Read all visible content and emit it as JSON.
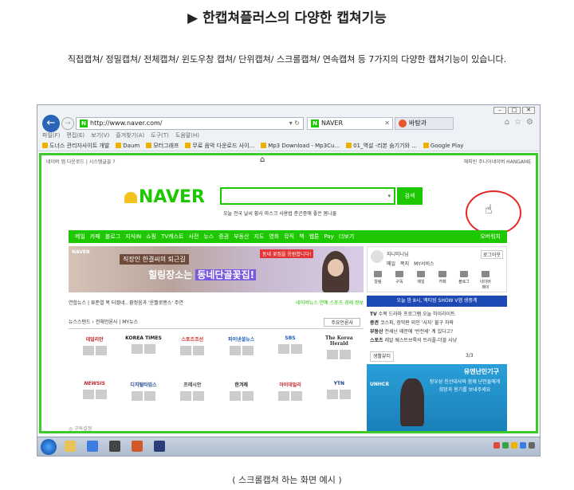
{
  "heading": "▶ 한캡쳐플러스의 다양한 캡쳐기능",
  "intro": "직접캡쳐/ 정밀캡쳐/ 전체캡쳐/ 윈도우창 캡쳐/ 단위캡쳐/ 스크롤캡쳐/ 연속캡쳐 등 7가지의 다양한  캡쳐기능이 있습니다.",
  "caption": "( 스크롤캡쳐 하는 화면 예시 )",
  "browser": {
    "address": "http://www.naver.com/",
    "address_controls": "▾ ↻",
    "tab1": "NAVER",
    "tab2": "바탕과",
    "menu": [
      "파일(F)",
      "편집(E)",
      "보기(V)",
      "즐겨찾기(A)",
      "도구(T)",
      "도움말(H)"
    ],
    "favorites": [
      "도너스 관리자사이트 개발",
      "Daum",
      "모터그래프",
      "무료 음악 다운로드 사이...",
      "Mp3 Download - Mp3Cu...",
      "01_역설 -리본 숨기기와 ...",
      "Google Play"
    ]
  },
  "naver": {
    "top_left": "네이버 앱 다운로드 | 시스템글꼴 ?",
    "top_right": "해피빈  주니어네이버  HANGAME",
    "logo": "NAVER",
    "search_button": "검색",
    "hot_keywords": "오늘 전국 날씨   황사 마스크 사용법   춘곤증에 좋은 봄나물",
    "menu": [
      "메일",
      "카페",
      "블로그",
      "지식iN",
      "쇼핑",
      "TV캐스트",
      "사전",
      "뉴스",
      "증권",
      "부동산",
      "지도",
      "영화",
      "뮤직",
      "책",
      "웹툰",
      "Pay",
      "더보기"
    ],
    "weather": "오버워치",
    "banner_brand": "NAVER",
    "banner_sub": "직장인 한결씨의 퇴근길",
    "banner_main_a": "힐링장소는 ",
    "banner_main_b": "동네단골꽃집!",
    "banner_badge": "동네 꽃집을 응원합니다!",
    "login_name": "지니미니님",
    "login_out": "로그아웃",
    "login_row": [
      "메일",
      "쪽지",
      "MY서비스"
    ],
    "login_icons": [
      "알림",
      "구독",
      "메일",
      "카페",
      "블로그",
      "네이버페이"
    ],
    "news_tabs": "연합뉴스 | 류준열 복 터졌네.. 황정음과 '운빨로맨스' 주연",
    "news_tabs_right": "네이버뉴스  연예  스포츠  경제  정보",
    "blue_banner": "오늘 밤 8시, 액티빙 SHOW V앱 생중계",
    "press_head": "뉴스스탠드 › 전체언론사 | MY뉴스",
    "press_select": "주요언론사",
    "press": [
      "데일리안",
      "KOREA TIMES",
      "스포츠조선",
      "파이낸셜뉴스",
      "SBS",
      "The Korea Herald",
      "NEWSIS",
      "디지털타임스",
      "프레시안",
      "한겨레",
      "아이데일리",
      "YTN"
    ],
    "topics": [
      {
        "tag": "TV",
        "text": "수목 드라마 프로그램 오늘 하이라이트"
      },
      {
        "tag": "증권",
        "text": "코스피, 장막판 외인 '사자' 불구 하락"
      },
      {
        "tag": "부동산",
        "text": "전세난 때문에 '반전세' 계 있다고?"
      },
      {
        "tag": "스포츠",
        "text": "레알 웨스트브룩의 트리플-더블 사냥"
      }
    ],
    "topics_foot": "생활뷰티",
    "topics_page": "3/3",
    "unicef_title": "유엔난민기구",
    "unicef_text": "정우성 친선대사와 함께 난민들에게 희망과 용기를 보내주세요",
    "unicef_logo": "UNHCR",
    "content_foot": "◎ 구독설정"
  },
  "colors": {
    "naver_green": "#1ec800",
    "capture_border": "#3ccb2a",
    "highlight_ring": "#e62828"
  }
}
